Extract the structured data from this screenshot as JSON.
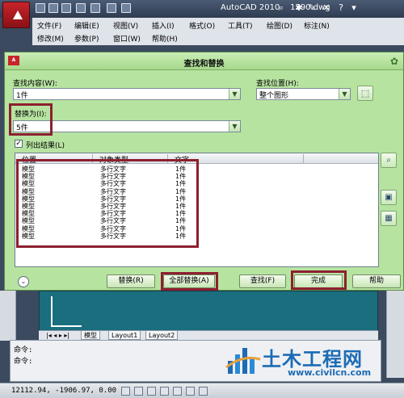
{
  "titlebar": {
    "app_title": "AutoCAD 2010",
    "file_name": "1290.dwg"
  },
  "menu": {
    "row1": [
      "文件(F)",
      "编辑(E)",
      "视图(V)",
      "插入(I)",
      "格式(O)",
      "工具(T)",
      "绘图(D)",
      "标注(N)"
    ],
    "row2": [
      "修改(M)",
      "参数(P)",
      "窗口(W)",
      "帮助(H)"
    ]
  },
  "dialog": {
    "title": "查找和替换",
    "find_label": "查找内容(W):",
    "find_value": "1件",
    "search_location_label": "查找位置(H):",
    "search_location_value": "整个图形",
    "replace_label": "替换为(I):",
    "replace_value": "5件",
    "list_results_label": "列出结果(L)",
    "list_results_checked": true,
    "columns": [
      "位置",
      "对象类型",
      "文字"
    ],
    "rows": [
      [
        "模型",
        "多行文字",
        "1件"
      ],
      [
        "模型",
        "多行文字",
        "1件"
      ],
      [
        "模型",
        "多行文字",
        "1件"
      ],
      [
        "模型",
        "多行文字",
        "1件"
      ],
      [
        "模型",
        "多行文字",
        "1件"
      ],
      [
        "模型",
        "多行文字",
        "1件"
      ],
      [
        "模型",
        "多行文字",
        "1件"
      ],
      [
        "模型",
        "多行文字",
        "1件"
      ],
      [
        "模型",
        "多行文字",
        "1件"
      ],
      [
        "模型",
        "多行文字",
        "1件"
      ]
    ],
    "buttons": {
      "replace": "替换(R)",
      "replace_all": "全部替换(A)",
      "find": "查找(F)",
      "done": "完成",
      "help": "帮助"
    }
  },
  "layout_tabs": [
    "模型",
    "Layout1",
    "Layout2"
  ],
  "command_line": [
    "命令:",
    "命令:"
  ],
  "status": {
    "coordinates": "12112.94, -1906.97, 0.00"
  },
  "watermark": {
    "title": "土木工程网",
    "url": "www.civilcn.com"
  },
  "colors": {
    "dialog_bg": "#b7e3a1",
    "highlight": "#8d1f2f",
    "drawing_bg": "#1a6e7d",
    "watermark": "#1d6bb5"
  }
}
